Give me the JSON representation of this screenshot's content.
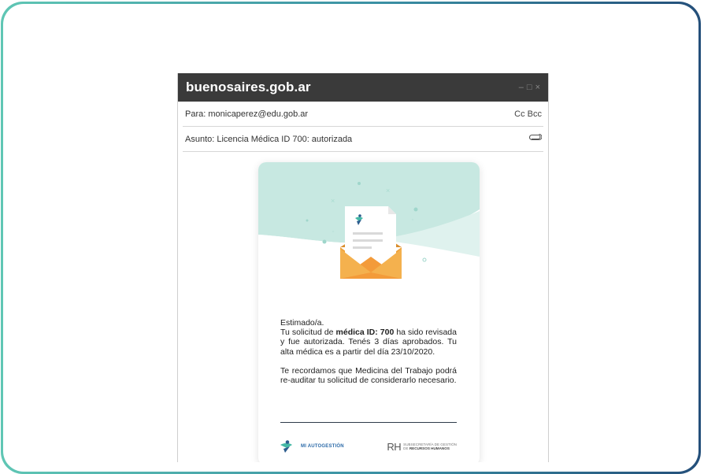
{
  "window": {
    "title": "buenosaires.gob.ar",
    "controls": [
      "–",
      "□",
      "×"
    ]
  },
  "header": {
    "to_label": "Para: monicaperez@edu.gob.ar",
    "cc_bcc": "Cc  Bcc",
    "subject_label": "Asunto: Licencia Médica ID 700: autorizada",
    "attach_icon": "paperclip-icon"
  },
  "email": {
    "greeting": "Estimado/a.",
    "p1_prefix": "Tu solicitud de ",
    "p1_bold": "médica ID: 700",
    "p1_suffix": " ha sido revisada y fue autorizada. Tenés 3 días aprobados. Tu alta médica es a partir del día 23/10/2020.",
    "p2": "Te recordamos que Medicina del Trabajo podrá re-auditar tu solicitud de considerarlo necesario."
  },
  "footer": {
    "brand_name": "MI AUTOGESTIÓN",
    "rh_mark": "RH",
    "rh_line1": "SUBSECRETARÍA DE GESTIÓN",
    "rh_line2_prefix": "DE ",
    "rh_line2_bold": "RECURSOS HUMANOS"
  },
  "colors": {
    "frame_start": "#5fc6b4",
    "frame_end": "#244f7a",
    "titlebar": "#3a3a3a",
    "hero_mint": "#c7e8e1",
    "envelope": "#f0a33a"
  }
}
